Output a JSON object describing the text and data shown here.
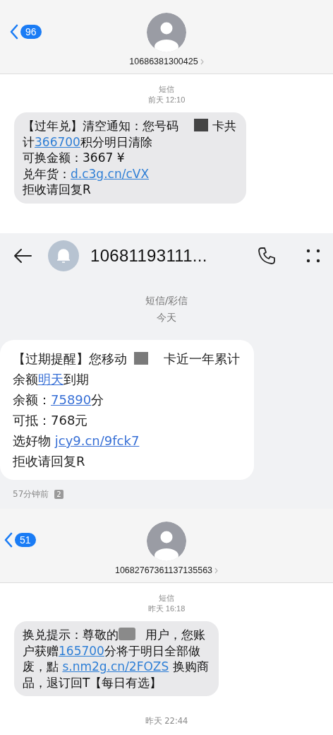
{
  "panels": [
    {
      "kind": "ios",
      "back_count": "96",
      "contact": "10686381300425",
      "service_label": "短信",
      "date_label": "前天 12:10",
      "message": {
        "lines": [
          [
            {
              "kind": "text",
              "text": "【过年兑】清空通知：您号码"
            },
            {
              "kind": "redacted"
            },
            {
              "kind": "text",
              "text": "卡共"
            }
          ],
          [
            {
              "kind": "text",
              "text": "计"
            },
            {
              "kind": "link",
              "text": "366700"
            },
            {
              "kind": "text",
              "text": "积分明日清除"
            }
          ],
          [
            {
              "kind": "text",
              "text": "可换金额：3667 ¥"
            }
          ],
          [
            {
              "kind": "text",
              "text": "兑年货："
            },
            {
              "kind": "link",
              "text": "d.c3g.cn/cVX"
            }
          ],
          [
            {
              "kind": "text",
              "text": "拒收请回复R"
            }
          ]
        ]
      }
    },
    {
      "kind": "android",
      "contact": "10681193111...",
      "service_label": "短信/彩信",
      "date_label": "今天",
      "message": {
        "lines": [
          [
            {
              "kind": "text",
              "text": "【过期提醒】您移动"
            },
            {
              "kind": "redacted"
            },
            {
              "kind": "text",
              "text": "卡近一年累计"
            }
          ],
          [
            {
              "kind": "text",
              "text": "余额"
            },
            {
              "kind": "link",
              "text": "明天"
            },
            {
              "kind": "text",
              "text": "到期"
            }
          ],
          [
            {
              "kind": "text",
              "text": "余额："
            },
            {
              "kind": "link",
              "text": "75890"
            },
            {
              "kind": "text",
              "text": "分"
            }
          ],
          [
            {
              "kind": "text",
              "text": "可抵：768元"
            }
          ],
          [
            {
              "kind": "text",
              "text": "选好物 "
            },
            {
              "kind": "link",
              "text": "jcy9.cn/9fck7"
            }
          ],
          [
            {
              "kind": "text",
              "text": "拒收请回复R"
            }
          ]
        ]
      },
      "footer_time": "57分钟前",
      "sim_badge": "2"
    },
    {
      "kind": "ios",
      "back_count": "51",
      "contact": "10682767361137135563",
      "service_label": "短信",
      "date_label": "昨天 16:18",
      "message": {
        "lines": [
          [
            {
              "kind": "text",
              "text": "换兑提示：尊敬的"
            },
            {
              "kind": "redacted"
            },
            {
              "kind": "text",
              "text": "用户，您账"
            }
          ],
          [
            {
              "kind": "text",
              "text": "户获赠"
            },
            {
              "kind": "link",
              "text": "165700"
            },
            {
              "kind": "text",
              "text": "分将于明日全部做"
            }
          ],
          [
            {
              "kind": "text",
              "text": "废，點 "
            },
            {
              "kind": "link",
              "text": "s.nm2g.cn/2FOZS"
            },
            {
              "kind": "text",
              "text": " 换购商"
            }
          ],
          [
            {
              "kind": "text",
              "text": "品，退订回T【每日有选】"
            }
          ]
        ]
      },
      "footer_time": "昨天 22:44"
    }
  ]
}
